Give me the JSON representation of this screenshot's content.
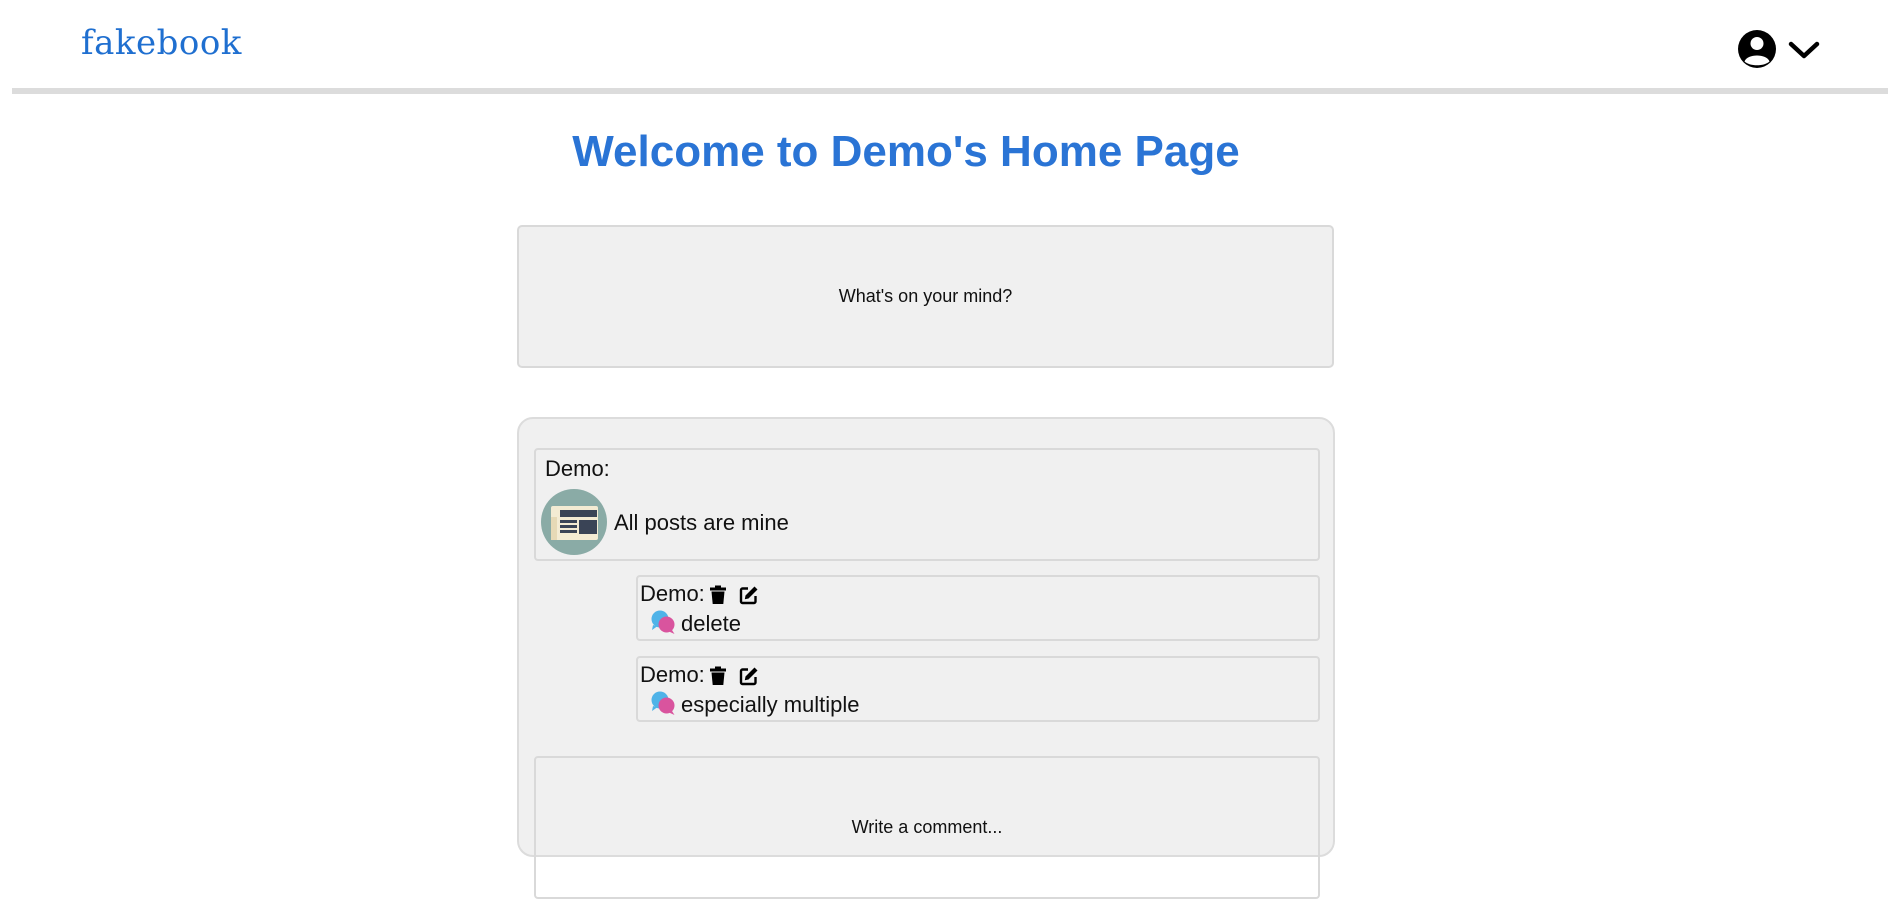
{
  "header": {
    "logo": "fakebook",
    "profile_icon": "user-circle-icon",
    "menu_icon": "chevron-down-icon"
  },
  "page": {
    "title": "Welcome to Demo's Home Page"
  },
  "composer": {
    "prompt": "What's on your mind?"
  },
  "feed": {
    "post": {
      "author": "Demo:",
      "avatar_icon": "newspaper-icon",
      "body": "All posts are mine"
    },
    "comments": [
      {
        "author": "Demo:",
        "text": "delete",
        "delete_icon": "trash-icon",
        "edit_icon": "edit-icon",
        "bubble_icon": "chat-bubbles-icon"
      },
      {
        "author": "Demo:",
        "text": "especially multiple",
        "delete_icon": "trash-icon",
        "edit_icon": "edit-icon",
        "bubble_icon": "chat-bubbles-icon"
      }
    ],
    "comment_prompt": "Write a comment..."
  },
  "colors": {
    "brand": "#1f6fd0",
    "title": "#2a74d5",
    "card_bg": "#f0f0f0",
    "border": "#d9d9d9"
  }
}
